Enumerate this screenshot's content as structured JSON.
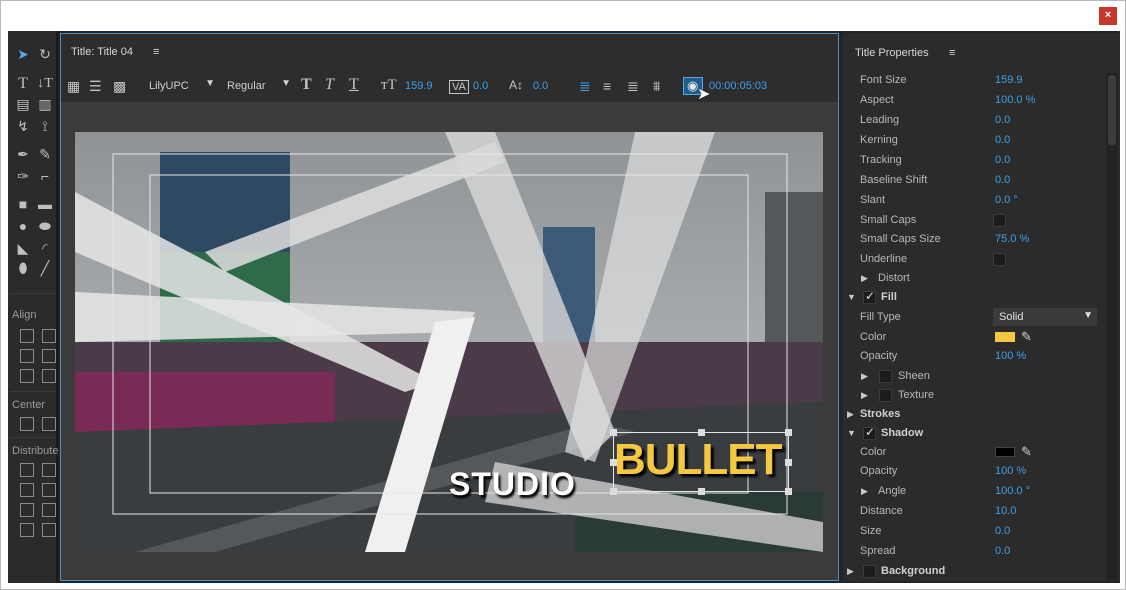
{
  "window": {
    "close": "×"
  },
  "tools": {
    "align_label": "Align",
    "center_label": "Center",
    "distribute_label": "Distribute"
  },
  "title_panel": {
    "title": "Title: Title 04",
    "menu_icon": "≡",
    "font": "LilyUPC",
    "style": "Regular",
    "font_size": "159.9",
    "kerning": "0.0",
    "leading": "0.0",
    "timecode": "00:00:05:03"
  },
  "canvas": {
    "text1": "STUDIO",
    "text2": "BULLET"
  },
  "properties": {
    "header": "Title Properties",
    "rows": {
      "font_size": {
        "label": "Font Size",
        "value": "159.9"
      },
      "aspect": {
        "label": "Aspect",
        "value": "100.0 %"
      },
      "leading": {
        "label": "Leading",
        "value": "0.0"
      },
      "kerning": {
        "label": "Kerning",
        "value": "0.0"
      },
      "tracking": {
        "label": "Tracking",
        "value": "0.0"
      },
      "baseline": {
        "label": "Baseline Shift",
        "value": "0.0"
      },
      "slant": {
        "label": "Slant",
        "value": "0.0 °"
      },
      "small_caps": {
        "label": "Small Caps"
      },
      "small_caps_size": {
        "label": "Small Caps Size",
        "value": "75.0 %"
      },
      "underline": {
        "label": "Underline"
      },
      "distort": {
        "label": "Distort"
      },
      "fill": {
        "label": "Fill"
      },
      "fill_type": {
        "label": "Fill Type",
        "value": "Solid"
      },
      "fill_color": {
        "label": "Color",
        "color": "#f5c842"
      },
      "fill_opacity": {
        "label": "Opacity",
        "value": "100 %"
      },
      "sheen": {
        "label": "Sheen"
      },
      "texture": {
        "label": "Texture"
      },
      "strokes": {
        "label": "Strokes"
      },
      "shadow": {
        "label": "Shadow"
      },
      "shadow_color": {
        "label": "Color",
        "color": "#000000"
      },
      "shadow_opacity": {
        "label": "Opacity",
        "value": "100 %"
      },
      "angle": {
        "label": "Angle",
        "value": "100.0 °"
      },
      "distance": {
        "label": "Distance",
        "value": "10.0"
      },
      "size": {
        "label": "Size",
        "value": "0.0"
      },
      "spread": {
        "label": "Spread",
        "value": "0.0"
      },
      "background": {
        "label": "Background"
      }
    }
  },
  "colors": {
    "accent": "#3fa0e8",
    "bullet_yellow": "#f5c842",
    "selection": "#4a90c8"
  }
}
